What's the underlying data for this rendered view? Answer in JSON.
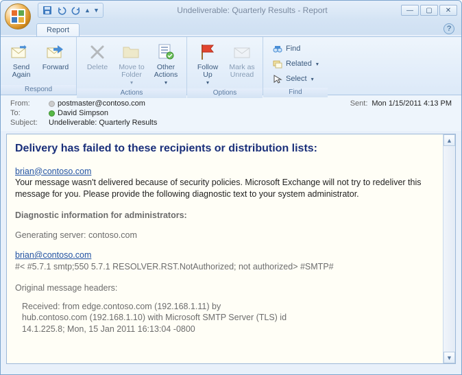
{
  "window": {
    "title": "Undeliverable: Quarterly Results - Report"
  },
  "tabs": {
    "primary": "Report"
  },
  "ribbon": {
    "respond": {
      "label": "Respond",
      "send_again": "Send\nAgain",
      "forward": "Forward"
    },
    "actions": {
      "label": "Actions",
      "delete": "Delete",
      "move_to_folder": "Move to\nFolder",
      "other_actions": "Other\nActions"
    },
    "options": {
      "label": "Options",
      "follow_up": "Follow\nUp",
      "mark_unread": "Mark as\nUnread"
    },
    "find": {
      "label": "Find",
      "find": "Find",
      "related": "Related",
      "select": "Select"
    }
  },
  "header": {
    "from_label": "From:",
    "from_value": "postmaster@contoso.com",
    "to_label": "To:",
    "to_value": "David Simpson",
    "subject_label": "Subject:",
    "subject_value": "Undeliverable: Quarterly Results",
    "sent_label": "Sent:",
    "sent_value": "Mon 1/15/2011 4:13 PM"
  },
  "body": {
    "heading": "Delivery has failed to these recipients or distribution lists:",
    "recipient1": "brian@contoso.com",
    "explain": "Your message wasn't delivered because of security policies. Microsoft Exchange will not try to redeliver this message for you. Please provide the following diagnostic text to your system administrator.",
    "diag_title": "Diagnostic information for administrators:",
    "gen_server": "Generating server: contoso.com",
    "recipient2": "brian@contoso.com",
    "smtp_line": "#< #5.7.1 smtp;550 5.7.1 RESOLVER.RST.NotAuthorized; not authorized> #SMTP#",
    "orig_headers_title": "Original message headers:",
    "hdr1": "Received: from edge.contoso.com (192.168.1.11) by",
    "hdr2": "hub.contoso.com (192.168.1.10) with Microsoft SMTP Server (TLS) id",
    "hdr3": "14.1.225.8;  Mon, 15 Jan 2011 16:13:04 -0800"
  }
}
